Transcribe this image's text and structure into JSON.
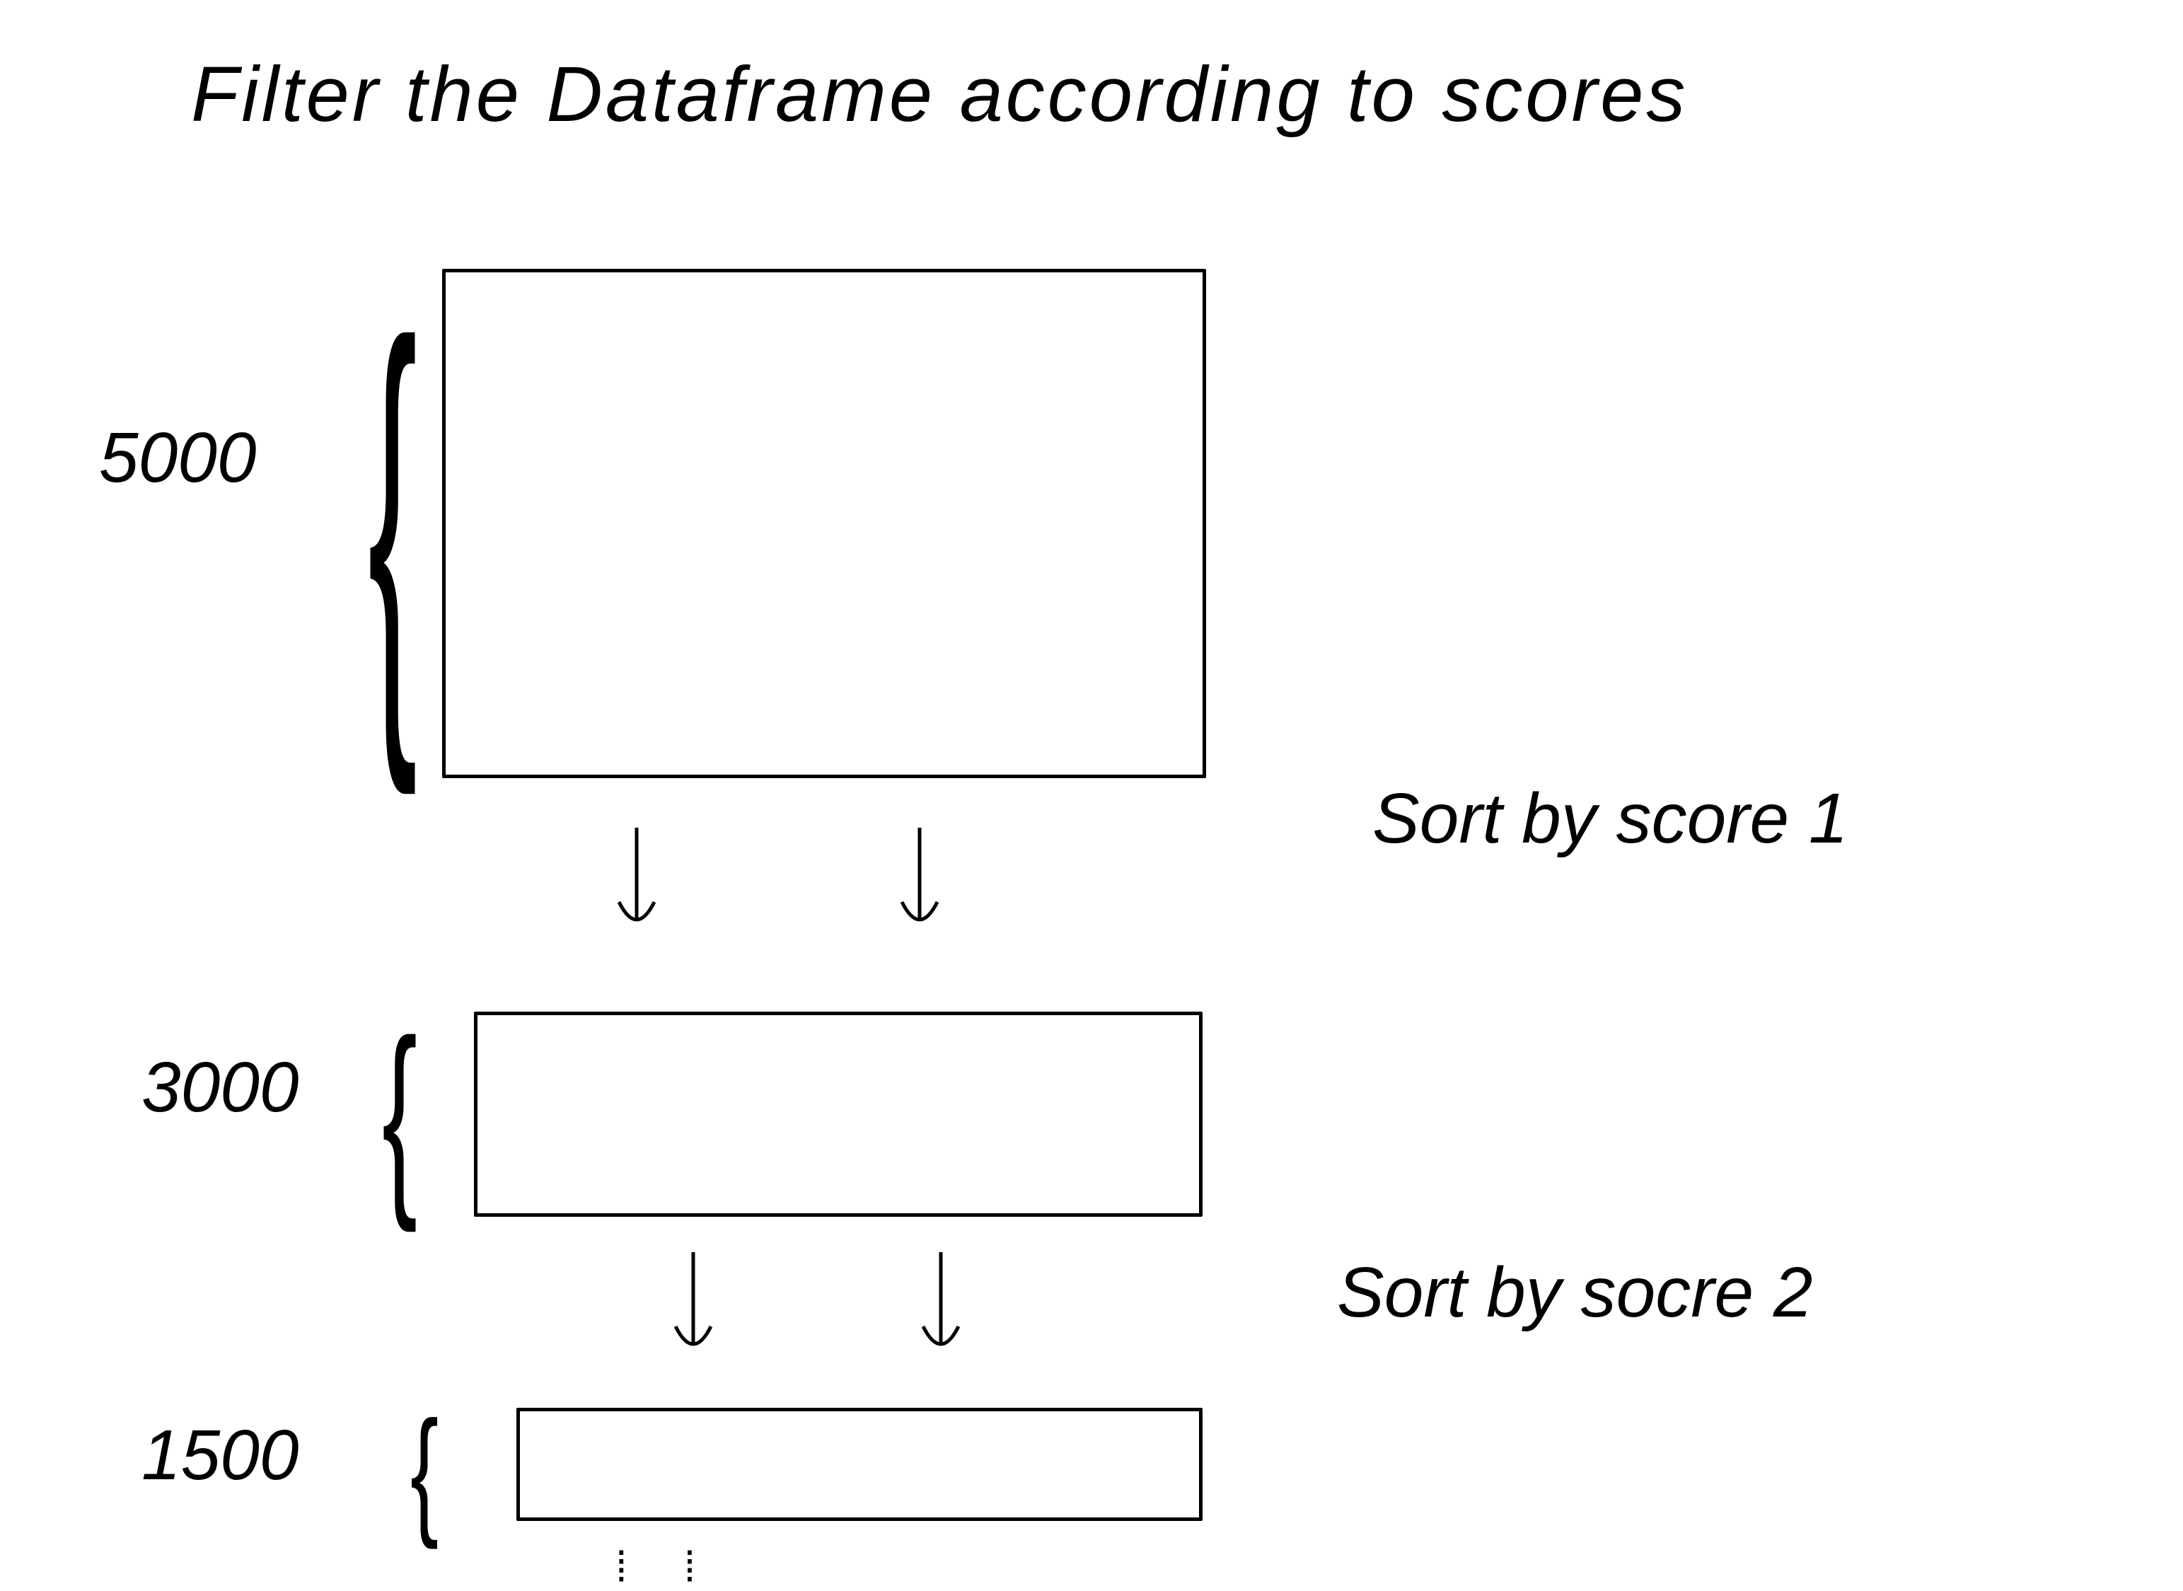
{
  "title": "Filter the Dataframe according to scores",
  "boxes": [
    {
      "id": "box-1",
      "row_count": "5000"
    },
    {
      "id": "box-2",
      "row_count": "3000"
    },
    {
      "id": "box-3",
      "row_count": "1500"
    }
  ],
  "steps": [
    {
      "id": "step-1",
      "label": "Sort by score 1"
    },
    {
      "id": "step-2",
      "label": "Sort by socre 2"
    }
  ]
}
